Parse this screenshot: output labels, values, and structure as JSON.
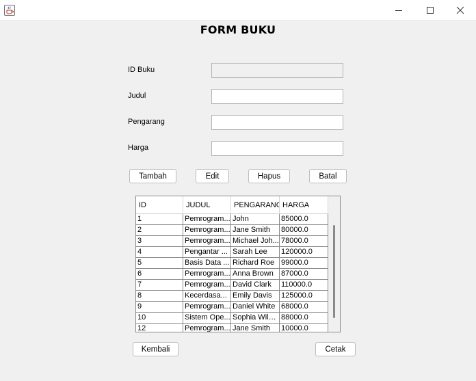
{
  "window": {
    "icon": "java-cup-icon",
    "minimize_icon": "minimize-icon",
    "maximize_icon": "maximize-icon",
    "close_icon": "close-icon"
  },
  "form": {
    "title": "FORM BUKU",
    "fields": {
      "id_label": "ID Buku",
      "id_value": "",
      "judul_label": "Judul",
      "judul_value": "",
      "pengarang_label": "Pengarang",
      "pengarang_value": "",
      "harga_label": "Harga",
      "harga_value": ""
    },
    "buttons": {
      "tambah": "Tambah",
      "edit": "Edit",
      "hapus": "Hapus",
      "batal": "Batal",
      "kembali": "Kembali",
      "cetak": "Cetak"
    }
  },
  "table": {
    "columns": [
      "ID",
      "JUDUL",
      "PENGARANG",
      "HARGA"
    ],
    "rows": [
      [
        "1",
        "Pemrogram...",
        "John",
        "85000.0"
      ],
      [
        "2",
        "Pemrogram...",
        "Jane Smith",
        "80000.0"
      ],
      [
        "3",
        "Pemrogram...",
        "Michael Joh...",
        "78000.0"
      ],
      [
        "4",
        "Pengantar ...",
        "Sarah Lee",
        "120000.0"
      ],
      [
        "5",
        "Basis Data ...",
        "Richard Roe",
        "99000.0"
      ],
      [
        "6",
        "Pemrogram...",
        "Anna Brown",
        "87000.0"
      ],
      [
        "7",
        "Pemrogram...",
        "David Clark",
        "110000.0"
      ],
      [
        "8",
        "Kecerdasa...",
        "Emily Davis",
        "125000.0"
      ],
      [
        "9",
        "Pemrogram...",
        "Daniel White",
        "68000.0"
      ],
      [
        "10",
        "Sistem Ope...",
        "Sophia Wilson",
        "88000.0"
      ],
      [
        "12",
        "Pemrogram...",
        "Jane Smith",
        "10000.0"
      ]
    ]
  }
}
